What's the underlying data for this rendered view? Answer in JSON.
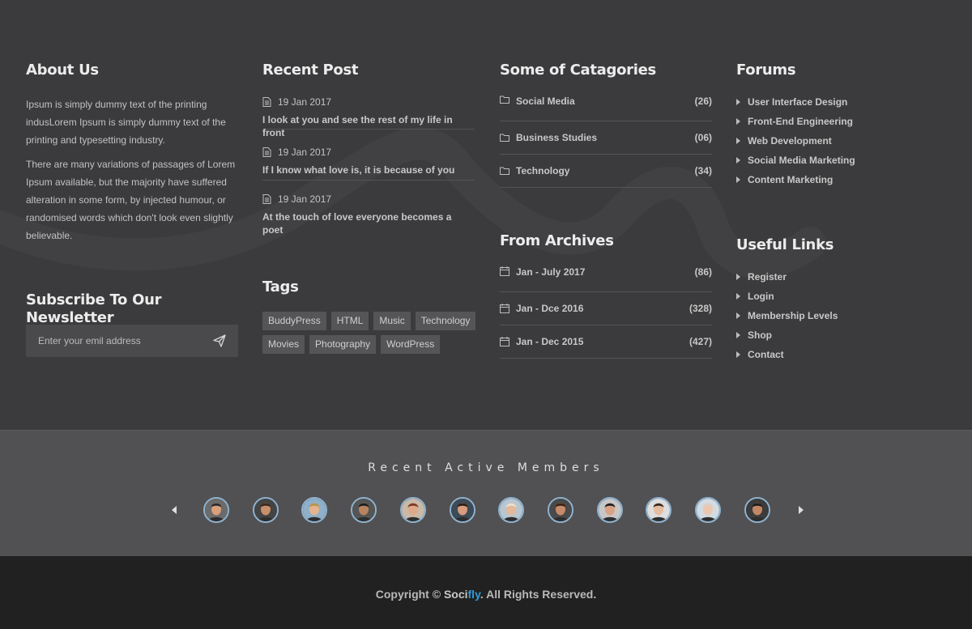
{
  "about": {
    "heading": "About Us",
    "p1": "Ipsum is simply dummy text of the printing indusLorem Ipsum is simply dummy text of the printing and typesetting industry.",
    "p2": "There are many variations of passages of Lorem Ipsum available, but the majority have suffered alteration in some form, by injected humour, or randomised words which don't look even slightly believable."
  },
  "newsletter": {
    "heading": "Subscribe To Our Newsletter",
    "placeholder": "Enter your emil address",
    "send_icon": "paper-plane-icon"
  },
  "recent_post": {
    "heading": "Recent Post",
    "posts": [
      {
        "date": "19 Jan 2017",
        "title": "I look at you and see the rest of my life in front"
      },
      {
        "date": "19 Jan 2017",
        "title": "If I know what love is, it is because of you"
      },
      {
        "date": "19 Jan 2017",
        "title": "At the touch of love everyone becomes a poet"
      }
    ]
  },
  "tags": {
    "heading": "Tags",
    "items": [
      "BuddyPress",
      "HTML",
      "Music",
      "Technology",
      "Movies",
      "Photography",
      "WordPress"
    ]
  },
  "categories": {
    "heading": "Some of Catagories",
    "items": [
      {
        "name": "Social Media",
        "count": "(26)"
      },
      {
        "name": "Business Studies",
        "count": "(06)"
      },
      {
        "name": "Technology",
        "count": "(34)"
      }
    ]
  },
  "archives": {
    "heading": "From Archives",
    "items": [
      {
        "name": "Jan - July 2017",
        "count": "(86)"
      },
      {
        "name": "Jan - Dce 2016",
        "count": "(328)"
      },
      {
        "name": "Jan - Dec 2015",
        "count": "(427)"
      }
    ]
  },
  "forums": {
    "heading": "Forums",
    "items": [
      "User Interface Design",
      "Front-End Engineering",
      "Web Development",
      "Social Media Marketing",
      "Content Marketing"
    ]
  },
  "useful_links": {
    "heading": "Useful Links",
    "items": [
      "Register",
      "Login",
      "Membership Levels",
      "Shop",
      "Contact"
    ]
  },
  "members": {
    "heading": "Recent Active Members",
    "count": 12
  },
  "copyright": {
    "prefix": "Copyright © ",
    "brand_a": "Soci",
    "brand_b": "fly",
    "suffix": ". All Rights Reserved."
  },
  "colors": {
    "background_top": "#3b3b3d",
    "members_band": "#515153",
    "bottom_bar": "#212121",
    "accent": "#2d9cdb"
  }
}
